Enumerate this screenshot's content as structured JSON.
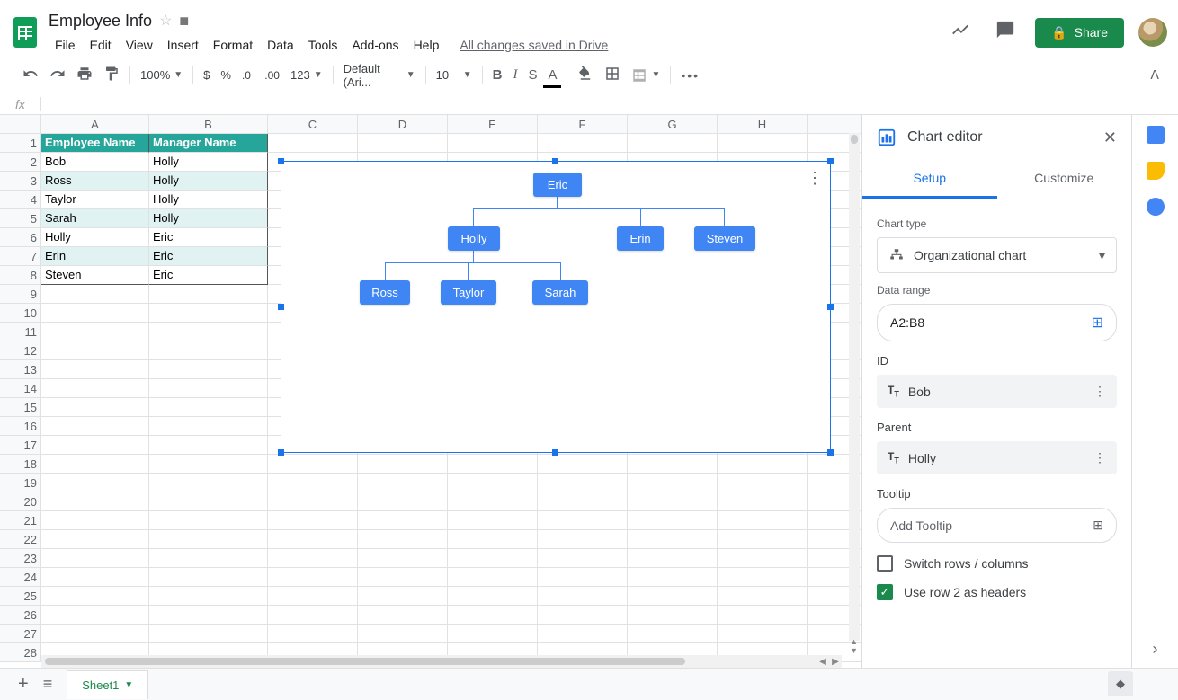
{
  "doc_title": "Employee Info",
  "menu": {
    "file": "File",
    "edit": "Edit",
    "view": "View",
    "insert": "Insert",
    "format": "Format",
    "data": "Data",
    "tools": "Tools",
    "addons": "Add-ons",
    "help": "Help"
  },
  "saved_status": "All changes saved in Drive",
  "share_label": "Share",
  "toolbar": {
    "zoom": "100%",
    "font": "Default (Ari...",
    "font_size": "10",
    "num_format": "123"
  },
  "columns": [
    "A",
    "B",
    "C",
    "D",
    "E",
    "F",
    "G",
    "H"
  ],
  "rows": [
    "1",
    "2",
    "3",
    "4",
    "5",
    "6",
    "7",
    "8",
    "9",
    "10",
    "11",
    "12",
    "13",
    "14",
    "15",
    "16",
    "17",
    "18",
    "19",
    "20",
    "21",
    "22",
    "23",
    "24",
    "25",
    "26",
    "27",
    "28"
  ],
  "table": {
    "headers": {
      "col1": "Employee Name",
      "col2": "Manager Name"
    },
    "data": [
      {
        "emp": "Bob",
        "mgr": "Holly"
      },
      {
        "emp": "Ross",
        "mgr": "Holly"
      },
      {
        "emp": "Taylor",
        "mgr": "Holly"
      },
      {
        "emp": "Sarah",
        "mgr": "Holly"
      },
      {
        "emp": "Holly",
        "mgr": "Eric"
      },
      {
        "emp": "Erin",
        "mgr": "Eric"
      },
      {
        "emp": "Steven",
        "mgr": "Eric"
      }
    ]
  },
  "chart_data": {
    "type": "org",
    "tree": {
      "name": "Eric",
      "children": [
        {
          "name": "Holly",
          "children": [
            {
              "name": "Ross"
            },
            {
              "name": "Taylor"
            },
            {
              "name": "Sarah"
            }
          ]
        },
        {
          "name": "Erin"
        },
        {
          "name": "Steven"
        }
      ]
    },
    "nodes": {
      "eric": "Eric",
      "holly": "Holly",
      "erin": "Erin",
      "steven": "Steven",
      "ross": "Ross",
      "taylor": "Taylor",
      "sarah": "Sarah"
    }
  },
  "sidebar": {
    "title": "Chart editor",
    "tab_setup": "Setup",
    "tab_customize": "Customize",
    "chart_type_label": "Chart type",
    "chart_type_value": "Organizational chart",
    "data_range_label": "Data range",
    "data_range_value": "A2:B8",
    "id_label": "ID",
    "id_value": "Bob",
    "parent_label": "Parent",
    "parent_value": "Holly",
    "tooltip_label": "Tooltip",
    "tooltip_placeholder": "Add Tooltip",
    "switch_rows": "Switch rows / columns",
    "use_headers": "Use row 2 as headers"
  },
  "bottom": {
    "sheet1": "Sheet1"
  }
}
